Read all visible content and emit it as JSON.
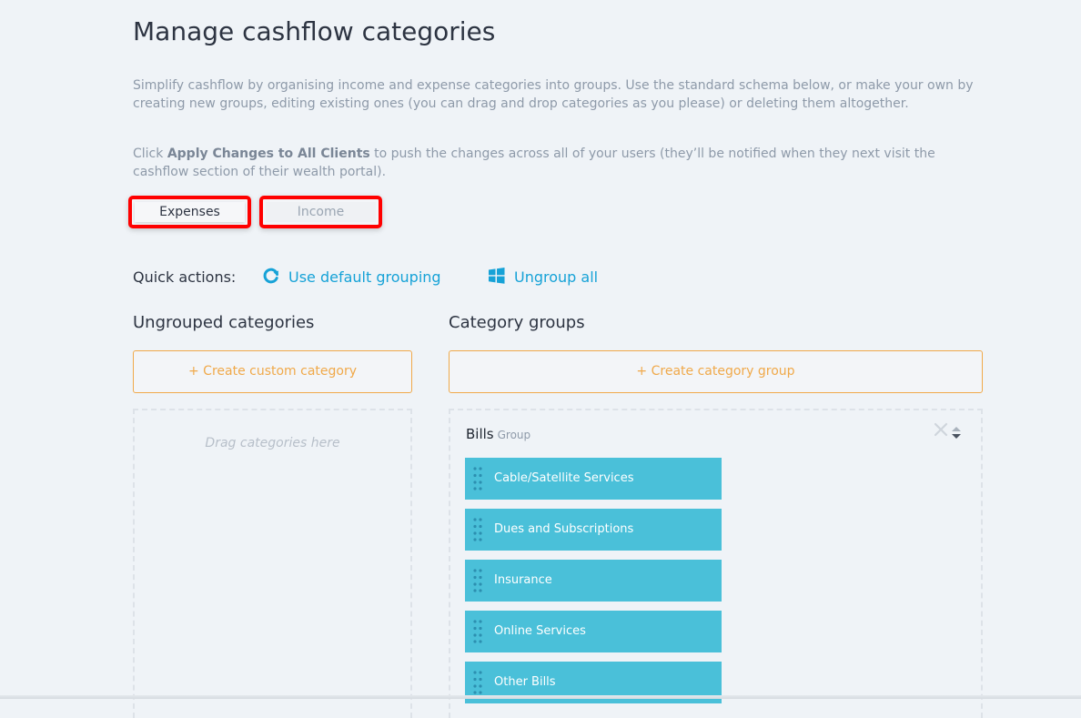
{
  "page": {
    "title": "Manage cashflow categories",
    "intro": "Simplify cashflow by organising income and expense categories into groups. Use the standard schema below, or make your own by creating new groups, editing existing ones (you can drag and drop categories as you please) or deleting them altogether.",
    "apply_prefix": "Click ",
    "apply_strong": "Apply Changes to All Clients",
    "apply_suffix": " to push the changes across all of your users (they’ll be notified when they next visit the cashflow section of their wealth portal)."
  },
  "tabs": [
    {
      "label": "Expenses",
      "active": true
    },
    {
      "label": "Income",
      "active": false
    }
  ],
  "quick_actions": {
    "label": "Quick actions:",
    "default_grouping": {
      "label": "Use default grouping",
      "icon": "refresh-icon"
    },
    "ungroup_all": {
      "label": "Ungroup all",
      "icon": "windows-grid-icon"
    }
  },
  "ungrouped": {
    "title": "Ungrouped categories",
    "create_label": "+ Create custom category",
    "drop_hint": "Drag categories here"
  },
  "groups": {
    "title": "Category groups",
    "create_label": "+ Create category group",
    "items": [
      {
        "name": "Bills",
        "tag": "Group",
        "categories": [
          "Cable/Satellite Services",
          "Dues and Subscriptions",
          "Insurance",
          "Online Services",
          "Other Bills"
        ]
      }
    ]
  },
  "colors": {
    "background": "#eff3f7",
    "accent_blue": "#16a2d7",
    "accent_orange": "#f0a94a",
    "category_tile": "#4ac0d9",
    "highlight_red": "#ff0000"
  }
}
